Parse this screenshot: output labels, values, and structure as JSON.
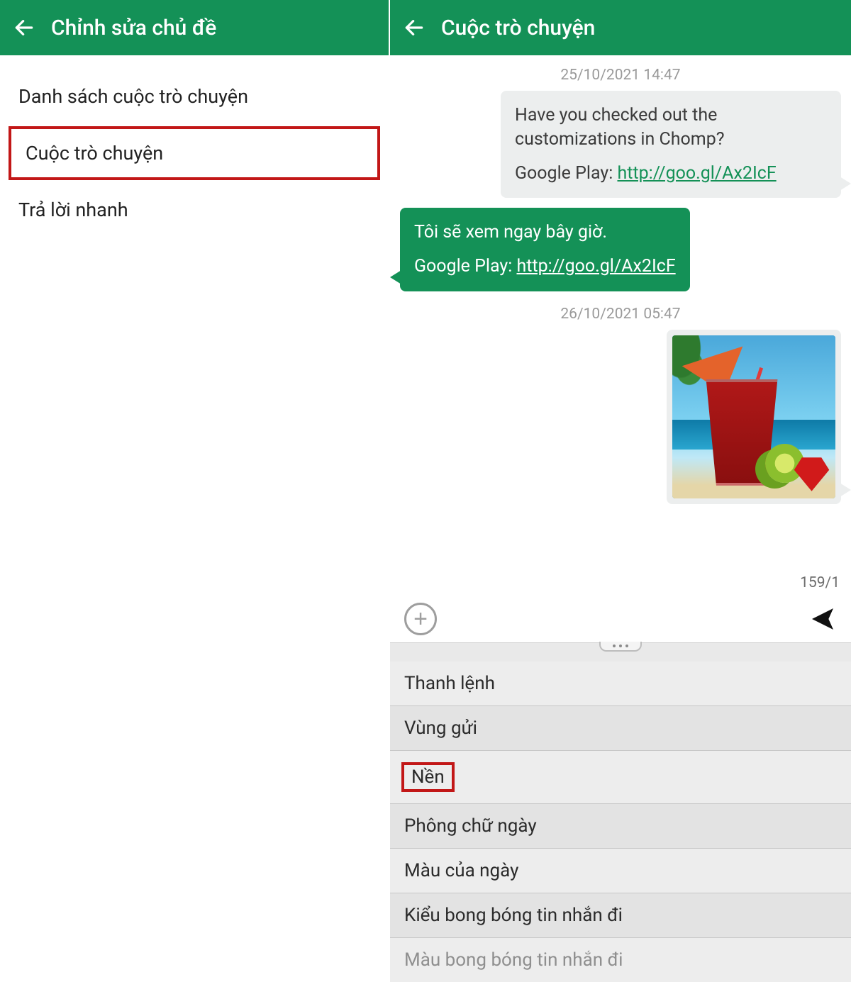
{
  "colors": {
    "brand": "#149157",
    "highlight": "#c21717"
  },
  "left": {
    "title": "Chỉnh sửa chủ đề",
    "items": {
      "list": "Danh sách cuộc trò chuyện",
      "convo": "Cuộc trò chuyện",
      "quick": "Trả lời nhanh"
    }
  },
  "right": {
    "title": "Cuộc trò chuyện",
    "ts1": "25/10/2021 14:47",
    "ts2": "26/10/2021 05:47",
    "msg_in_line1": "Have you checked out the customizations in Chomp?",
    "msg_in_prefix": "Google Play: ",
    "msg_in_link": "http://goo.gl/Ax2IcF",
    "msg_out_line1": "Tôi sẽ xem ngay bây giờ.",
    "msg_out_prefix": "Google Play: ",
    "msg_out_link": "http://goo.gl/Ax2IcF",
    "counter": "159/1",
    "sheet": {
      "o1": "Thanh lệnh",
      "o2": "Vùng gửi",
      "o3": "Nền",
      "o4": "Phông chữ ngày",
      "o5": "Màu của ngày",
      "o6": "Kiểu bong bóng tin nhắn đi",
      "o7": "Màu bong bóng tin nhắn đi"
    }
  }
}
